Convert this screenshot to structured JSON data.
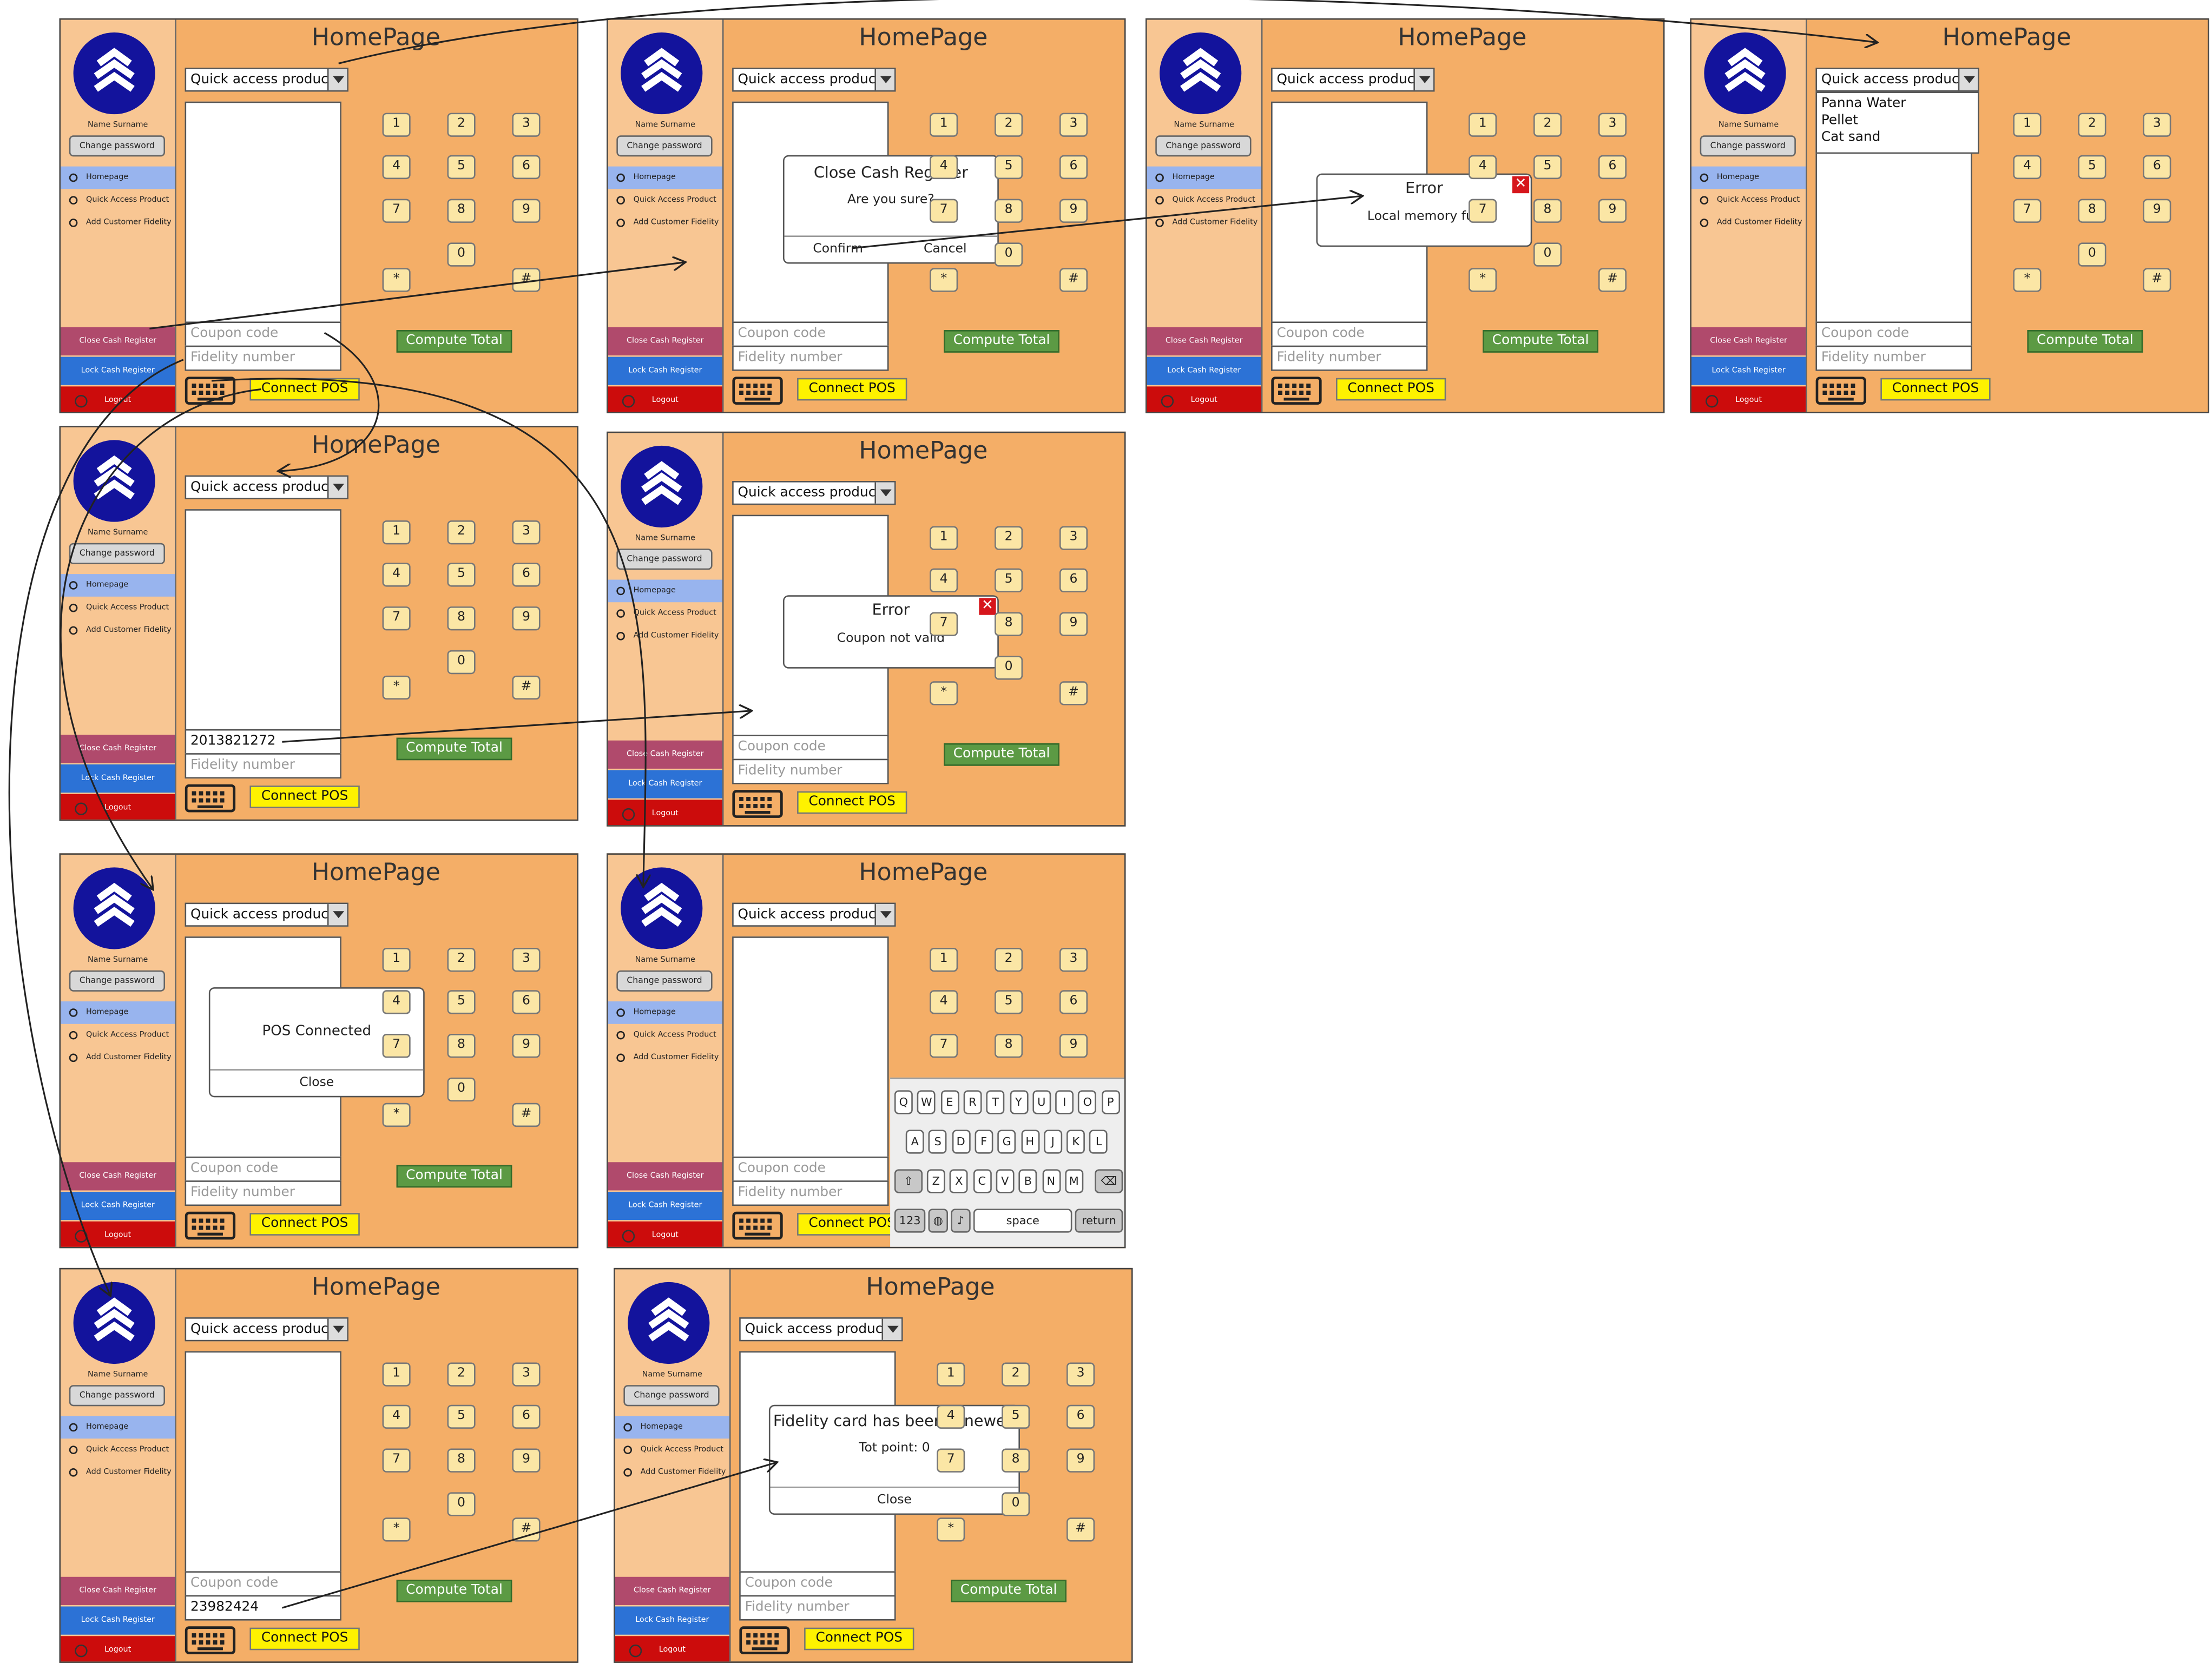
{
  "screen_common": {
    "title": "HomePage",
    "user_name": "Name Surname",
    "change_password": "Change password",
    "nav": [
      "Homepage",
      "Quick Access Product",
      "Add Customer Fidelity"
    ],
    "close_register": "Close Cash Register",
    "lock_register": "Lock Cash Register",
    "logout": "Logout",
    "dropdown": "Quick access product",
    "coupon_placeholder": "Coupon code",
    "fidelity_placeholder": "Fidelity number",
    "keypad": [
      "1",
      "2",
      "3",
      "4",
      "5",
      "6",
      "7",
      "8",
      "9",
      "0",
      "*",
      "#"
    ],
    "compute_total": "Compute Total",
    "connect_pos": "Connect POS"
  },
  "screens": [
    {
      "id": "s1"
    },
    {
      "id": "s2",
      "dialog": {
        "title": "Close Cash Register",
        "text": "Are you sure?",
        "buttons": [
          "Confirm",
          "Cancel"
        ]
      }
    },
    {
      "id": "s3",
      "error": {
        "title": "Error",
        "text": "Local memory full"
      }
    },
    {
      "id": "s4",
      "dropdown_options": [
        "Panna Water",
        "Pellet",
        "Cat sand"
      ]
    },
    {
      "id": "s5",
      "coupon_value": "2013821272"
    },
    {
      "id": "s6",
      "error": {
        "title": "Error",
        "text": "Coupon not valid"
      }
    },
    {
      "id": "s7",
      "dialog": {
        "text": "POS Connected",
        "buttons": [
          "Close"
        ]
      }
    },
    {
      "id": "s8",
      "keyboard": {
        "row1": [
          "Q",
          "W",
          "E",
          "R",
          "T",
          "Y",
          "U",
          "I",
          "O",
          "P"
        ],
        "row2": [
          "A",
          "S",
          "D",
          "F",
          "G",
          "H",
          "J",
          "K",
          "L"
        ],
        "row3": [
          "Z",
          "X",
          "C",
          "V",
          "B",
          "N",
          "M"
        ],
        "numbers_key": "123",
        "space_key": "space",
        "return_key": "return"
      }
    },
    {
      "id": "s9",
      "fidelity_value": "23982424"
    },
    {
      "id": "s10",
      "dialog": {
        "title": "Fidelity card has been renewed",
        "text": "Tot point: 0",
        "buttons": [
          "Close"
        ]
      }
    }
  ],
  "colors": {
    "screen_bg": "#f4ae67",
    "sidebar_bg": "#f8c693",
    "logo_bg": "#13139c",
    "nav_active": "#98b4ee",
    "close_btn": "#b04a6c",
    "lock_btn": "#2c72d6",
    "logout_btn": "#cc0c0c",
    "compute_btn": "#5c9a44",
    "connect_btn": "#fef200",
    "key_bg": "#fbe6a5"
  },
  "icons": [
    "logo-chevrons-icon",
    "logout-icon",
    "keyboard-icon",
    "dropdown-arrow-icon",
    "close-x-icon"
  ]
}
